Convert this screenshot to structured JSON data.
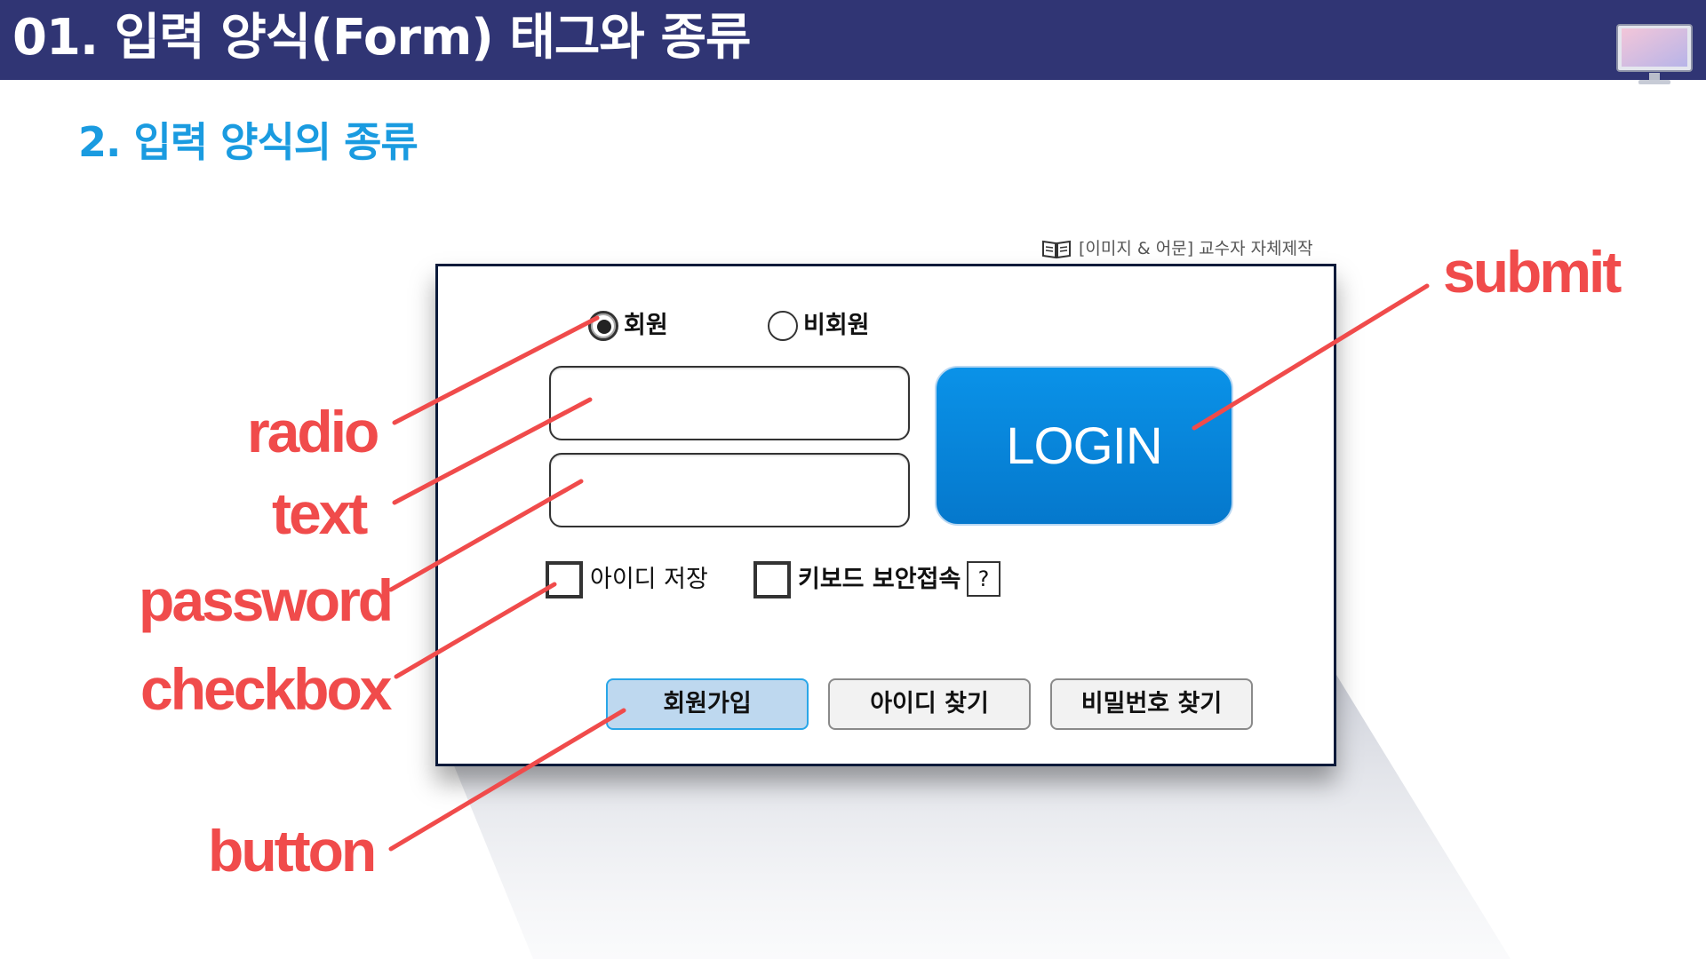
{
  "header": {
    "title": "01. 입력 양식(Form) 태그와 종류"
  },
  "subtitle": "2. 입력 양식의 종류",
  "credit": "[이미지 & 어문] 교수자 자체제작",
  "form": {
    "radio_member": "회원",
    "radio_guest": "비회원",
    "login_label": "LOGIN",
    "remember_id": "아이디 저장",
    "keyboard_security": "키보드 보안접속",
    "help_label": "?",
    "buttons": [
      "회원가입",
      "아이디 찾기",
      "비밀번호 찾기"
    ]
  },
  "annotations": {
    "radio": "radio",
    "text": "text",
    "password": "password",
    "checkbox": "checkbox",
    "button": "button",
    "submit": "submit"
  },
  "colors": {
    "header_bg": "#303574",
    "subtitle": "#1a9be0",
    "annotation": "#f04b4b",
    "login_bg": "#0a8ae0"
  }
}
